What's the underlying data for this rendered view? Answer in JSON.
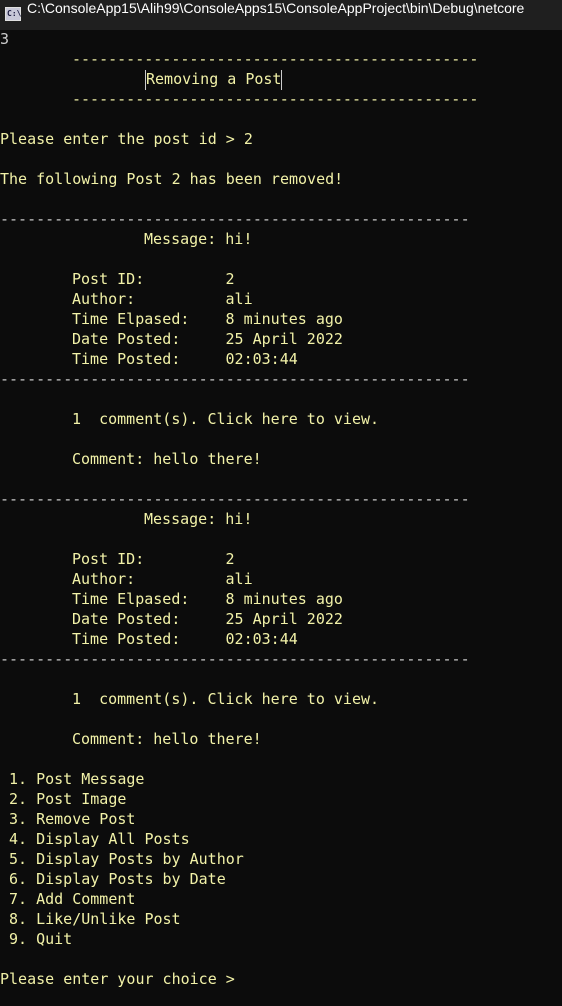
{
  "window": {
    "title": "C:\\ConsoleApp15\\Alih99\\ConsoleApps15\\ConsoleAppProject\\bin\\Debug\\netcore",
    "icon": "console-app-icon",
    "icon_glyph": "C:\\"
  },
  "console": {
    "input_choice": "3",
    "header_rule_top": "---------------------------------------------",
    "header_title": "Removing a Post",
    "header_rule_bottom": "---------------------------------------------",
    "prompt_post_id": "Please enter the post id > 2",
    "removed_message": "The following Post 2 has been removed!",
    "posts": [
      {
        "rule_top": "----------------------------------------------------",
        "message": "Message: hi!",
        "post_id": "Post ID:         2",
        "author": "Author:          ali",
        "time_elapsed": "Time Elpased:    8 minutes ago",
        "date_posted": "Date Posted:     25 April 2022",
        "time_posted": "Time Posted:     02:03:44",
        "rule_bottom": "----------------------------------------------------",
        "comments_link": "1  comment(s). Click here to view.",
        "comment": "Comment: hello there!"
      },
      {
        "rule_top": "----------------------------------------------------",
        "message": "Message: hi!",
        "post_id": "Post ID:         2",
        "author": "Author:          ali",
        "time_elapsed": "Time Elpased:    8 minutes ago",
        "date_posted": "Date Posted:     25 April 2022",
        "time_posted": "Time Posted:     02:03:44",
        "rule_bottom": "----------------------------------------------------",
        "comments_link": "1  comment(s). Click here to view.",
        "comment": "Comment: hello there!"
      }
    ],
    "menu": [
      "1. Post Message",
      "2. Post Image",
      "3. Remove Post",
      "4. Display All Posts",
      "5. Display Posts by Author",
      "6. Display Posts by Date",
      "7. Add Comment",
      "8. Like/Unlike Post",
      "9. Quit"
    ],
    "choice_prompt": "Please enter your choice >"
  },
  "colors": {
    "background": "#0c0c0c",
    "titlebar": "#1f1f1f",
    "text": "#cccccc",
    "highlight_text": "#f2f2a8"
  }
}
